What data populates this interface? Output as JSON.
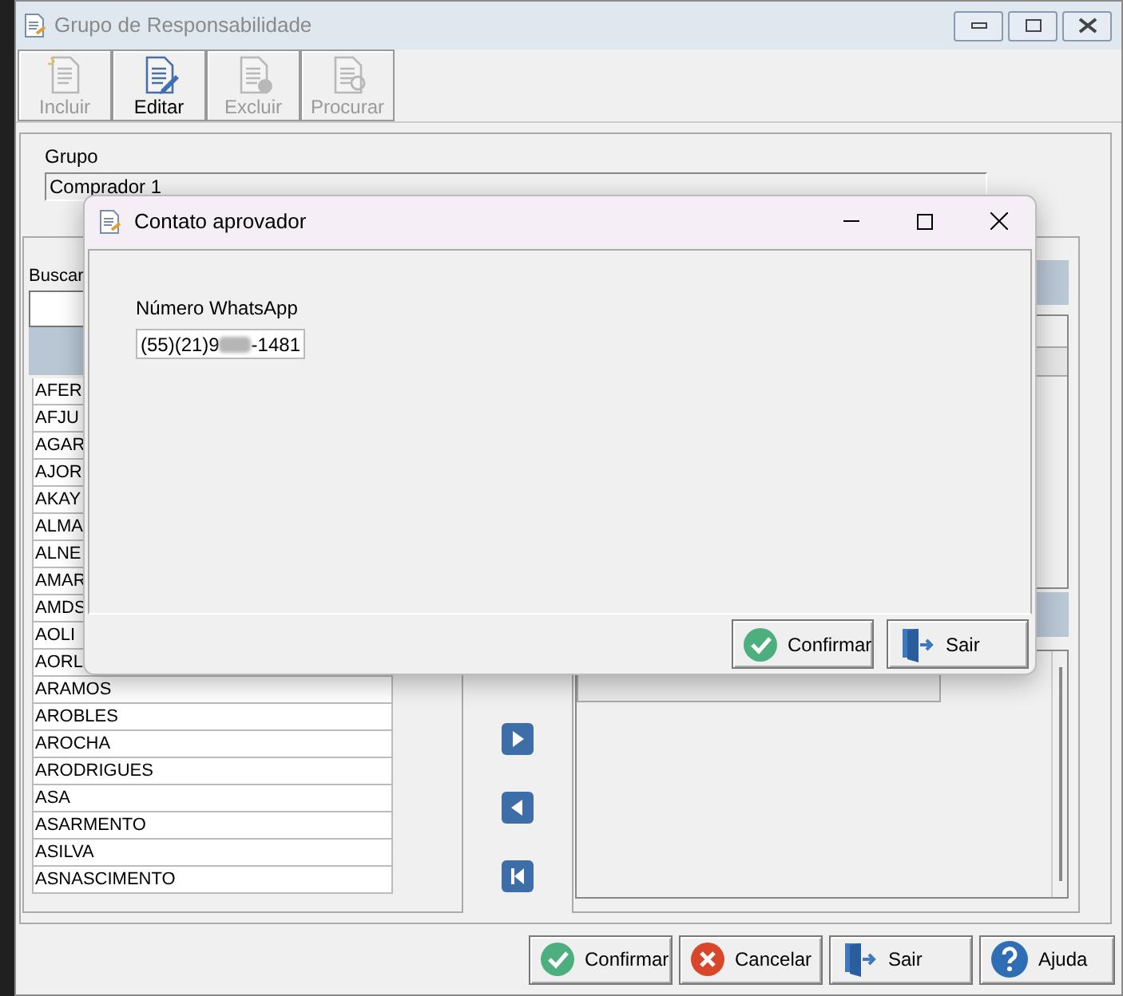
{
  "window": {
    "title": "Grupo de Responsabilidade"
  },
  "toolbar": [
    {
      "label": "Incluir",
      "kind": "add",
      "disabled": true
    },
    {
      "label": "Editar",
      "kind": "edit",
      "disabled": false
    },
    {
      "label": "Excluir",
      "kind": "delete",
      "disabled": true
    },
    {
      "label": "Procurar",
      "kind": "find",
      "disabled": true
    }
  ],
  "group_field": {
    "label": "Grupo",
    "value": "Comprador 1"
  },
  "search": {
    "label": "Buscar"
  },
  "users": [
    "AFER",
    "AFJU",
    "AGAR",
    "AJOR",
    "AKAY",
    "ALMA",
    "ALNE",
    "AMAR",
    "AMDS",
    "AOLI",
    "AORL",
    "ARAMOS",
    "AROBLES",
    "AROCHA",
    "ARODRIGUES",
    "ASA",
    "ASARMENTO",
    "ASILVA",
    "ASNASCIMENTO"
  ],
  "move_buttons": [
    {
      "kind": "right"
    },
    {
      "kind": "left"
    },
    {
      "kind": "first"
    }
  ],
  "buttons": [
    {
      "label": "Confirmar",
      "kind": "confirm"
    },
    {
      "label": "Cancelar",
      "kind": "cancel"
    },
    {
      "label": "Sair",
      "kind": "exit"
    },
    {
      "label": "Ajuda",
      "kind": "help"
    }
  ],
  "dialog": {
    "title": "Contato aprovador",
    "field_label": "Número WhatsApp",
    "value_prefix": "(55)(21)9",
    "redacted": true,
    "value_suffix": "-1481",
    "buttons": [
      {
        "label": "Confirmar",
        "kind": "confirm"
      },
      {
        "label": "Sair",
        "kind": "exit"
      }
    ]
  }
}
